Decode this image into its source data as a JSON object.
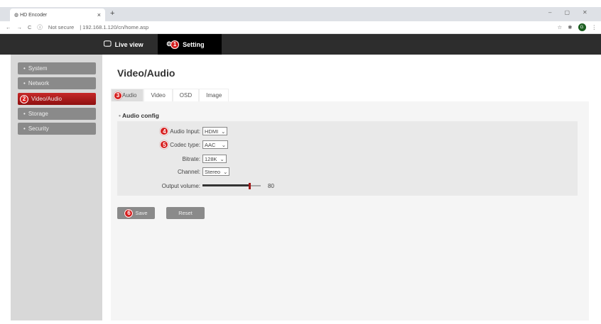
{
  "browser": {
    "tab_title": "HD Encoder",
    "url_warning": "Not secure",
    "url": "192.168.1.120/cn/home.asp",
    "profile_initial": "G"
  },
  "nav": {
    "live_view": "Live view",
    "setting": "Setting"
  },
  "sidebar": {
    "items": [
      {
        "label": "System"
      },
      {
        "label": "Network"
      },
      {
        "label": "Video/Audio"
      },
      {
        "label": "Storage"
      },
      {
        "label": "Security"
      }
    ]
  },
  "page_title": "Video/Audio",
  "tabs": [
    {
      "label": "Audio"
    },
    {
      "label": "Video"
    },
    {
      "label": "OSD"
    },
    {
      "label": "Image"
    }
  ],
  "section": "Audio config",
  "fields": {
    "audio_input": {
      "label": "Audio Input:",
      "value": "HDMI"
    },
    "codec_type": {
      "label": "Codec type:",
      "value": "AAC"
    },
    "bitrate": {
      "label": "Bitrate:",
      "value": "128K"
    },
    "channel": {
      "label": "Channel:",
      "value": "Stereo"
    },
    "output_volume": {
      "label": "Output volume:",
      "value": "80",
      "fraction": 0.8
    }
  },
  "buttons": {
    "save": "Save",
    "reset": "Reset"
  },
  "annotations": [
    "1",
    "2",
    "3",
    "4",
    "5",
    "6"
  ],
  "colors": {
    "accent": "#b71c1c",
    "badge": "#d61f1f"
  }
}
